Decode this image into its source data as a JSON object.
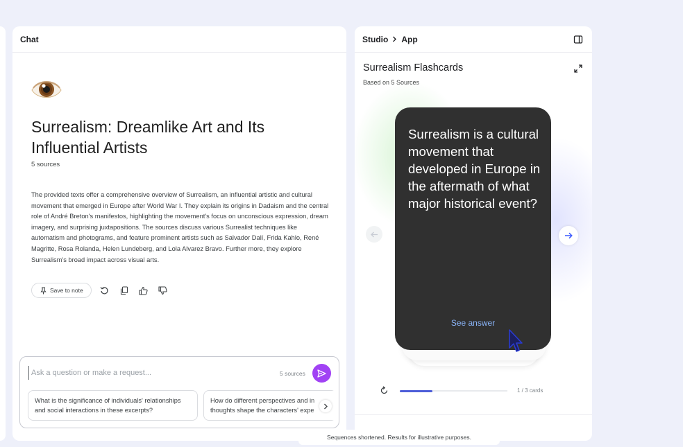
{
  "chat": {
    "header_title": "Chat",
    "notebook": {
      "emoji": "👁️",
      "title": "Surrealism: Dreamlike Art and Its Influential Artists",
      "sources_count": "5 sources",
      "summary": "The provided texts offer a comprehensive overview of Surrealism, an influential artistic and cultural movement that emerged in Europe after World War I. They explain its origins in Dadaism and the central role of André Breton's manifestos, highlighting the movement's focus on unconscious expression, dream imagery, and surprising juxtapositions. The sources discuss various Surrealist techniques like automatism and photograms, and feature prominent artists such as Salvador Dalí, Frida Kahlo, René Magritte, Rosa Rolanda, Helen Lundeberg, and Lola Alvarez Bravo. Further more, they explore Surrealism's broad impact across visual arts."
    },
    "actions": {
      "save_to_note": "Save to note",
      "icons": [
        "pin-icon",
        "refresh-icon",
        "copy-icon",
        "thumbs-up-icon",
        "thumbs-down-icon"
      ]
    },
    "input": {
      "placeholder": "Ask a question or make a request...",
      "value": "",
      "sources_label": "5 sources",
      "send_icon": "send-icon"
    },
    "suggestions": [
      "What is the significance of individuals' relationships and social interactions in these excerpts?",
      "How do different perspectives and in",
      "thoughts shape the characters' expe"
    ]
  },
  "studio": {
    "breadcrumb": [
      "Studio",
      "App"
    ],
    "flashcards": {
      "title": "Surrealism Flashcards",
      "subtitle": "Based on 5 Sources",
      "question": "Surrealism is a cultural movement that developed in Europe in the aftermath of what major historical event?",
      "see_answer": "See answer",
      "progress_fraction": 0.3,
      "card_count": "1 / 3 cards"
    }
  },
  "footer": {
    "disclaimer": "Sequences shortened. Results for illustrative purposes."
  },
  "colors": {
    "background": "#eef0fa",
    "flashcard": "#303030",
    "accent_purple": "#a142f4",
    "progress_blue": "#4c5dd8",
    "see_answer_blue": "#8ab4f8"
  }
}
